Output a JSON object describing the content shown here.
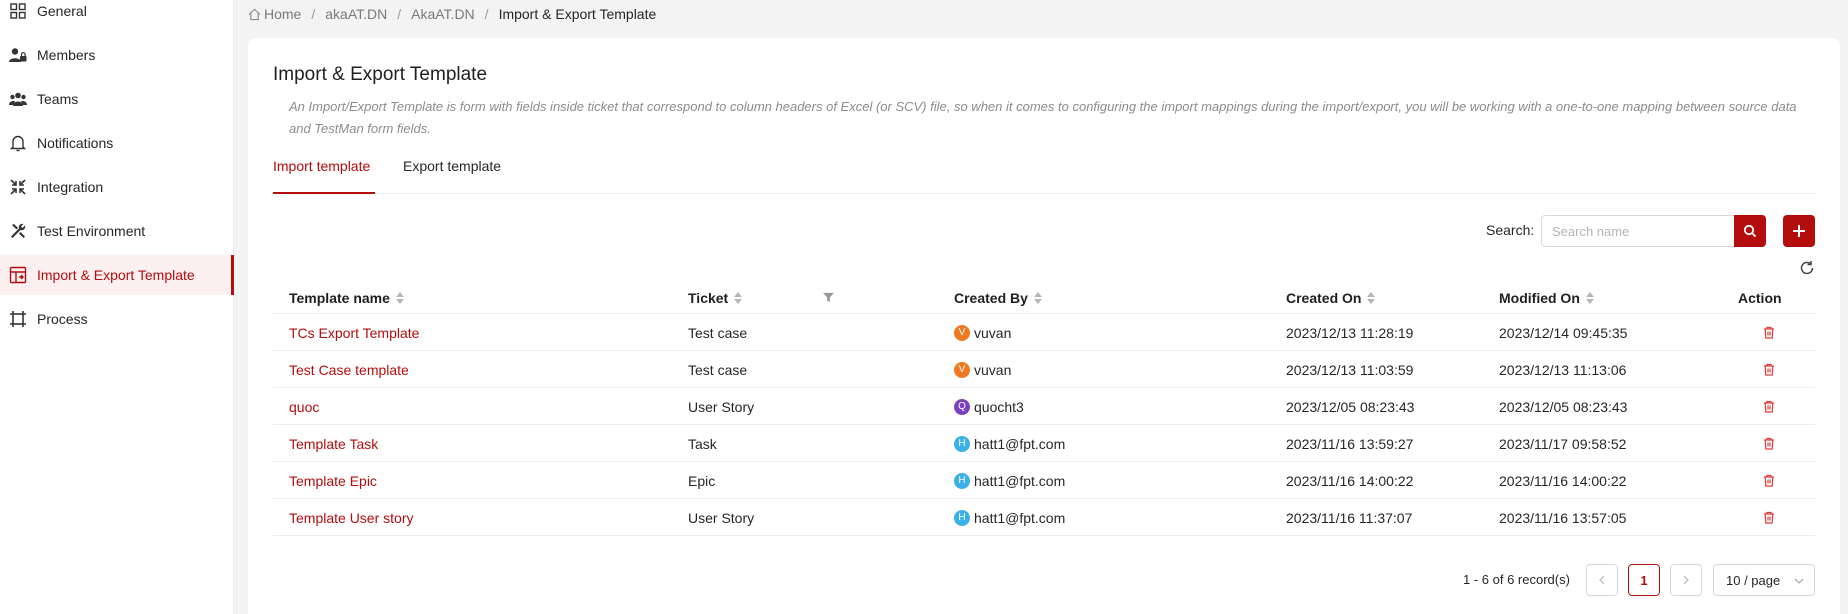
{
  "sidebar": {
    "items": [
      {
        "label": "General",
        "icon": "grid-icon"
      },
      {
        "label": "Members",
        "icon": "member-lock-icon"
      },
      {
        "label": "Teams",
        "icon": "team-icon"
      },
      {
        "label": "Notifications",
        "icon": "bell-icon"
      },
      {
        "label": "Integration",
        "icon": "integration-icon"
      },
      {
        "label": "Test Environment",
        "icon": "tools-icon"
      },
      {
        "label": "Import & Export Template",
        "icon": "template-icon",
        "active": true
      },
      {
        "label": "Process",
        "icon": "process-icon"
      }
    ]
  },
  "breadcrumb": {
    "home": "Home",
    "crumb1": "akaAT.DN",
    "crumb2": "AkaAT.DN",
    "current": "Import & Export Template"
  },
  "page": {
    "title": "Import & Export Template",
    "description": "An Import/Export Template is form with fields inside ticket that correspond to column headers of Excel (or SCV) file, so when it comes to configuring the import mappings during the import/export, you will be working with a one-to-one mapping between source data and TestMan form fields."
  },
  "tabs": {
    "import": "Import template",
    "export": "Export template"
  },
  "search": {
    "label": "Search:",
    "placeholder": "Search name"
  },
  "table": {
    "headers": {
      "name": "Template name",
      "ticket": "Ticket",
      "created_by": "Created By",
      "created_on": "Created On",
      "modified_on": "Modified On",
      "action": "Action"
    },
    "rows": [
      {
        "name": "TCs Export Template",
        "ticket": "Test case",
        "avatar": "V",
        "avatar_color": "#f07a22",
        "user": "vuvan",
        "created": "2023/12/13 11:28:19",
        "modified": "2023/12/14 09:45:35"
      },
      {
        "name": "Test Case template",
        "ticket": "Test case",
        "avatar": "V",
        "avatar_color": "#f07a22",
        "user": "vuvan",
        "created": "2023/12/13 11:03:59",
        "modified": "2023/12/13 11:13:06"
      },
      {
        "name": "quoc",
        "ticket": "User Story",
        "avatar": "Q",
        "avatar_color": "#7b3fbf",
        "user": "quocht3",
        "created": "2023/12/05 08:23:43",
        "modified": "2023/12/05 08:23:43"
      },
      {
        "name": "Template Task",
        "ticket": "Task",
        "avatar": "H",
        "avatar_color": "#3ab0e8",
        "user": "hatt1@fpt.com",
        "created": "2023/11/16 13:59:27",
        "modified": "2023/11/17 09:58:52"
      },
      {
        "name": "Template Epic",
        "ticket": "Epic",
        "avatar": "H",
        "avatar_color": "#3ab0e8",
        "user": "hatt1@fpt.com",
        "created": "2023/11/16 14:00:22",
        "modified": "2023/11/16 14:00:22"
      },
      {
        "name": "Template User story",
        "ticket": "User Story",
        "avatar": "H",
        "avatar_color": "#3ab0e8",
        "user": "hatt1@fpt.com",
        "created": "2023/11/16 11:37:07",
        "modified": "2023/11/16 13:57:05"
      }
    ]
  },
  "pagination": {
    "total": "1 - 6 of 6 record(s)",
    "current_page": "1",
    "page_size": "10 / page"
  },
  "colors": {
    "accent": "#b30d0d"
  }
}
